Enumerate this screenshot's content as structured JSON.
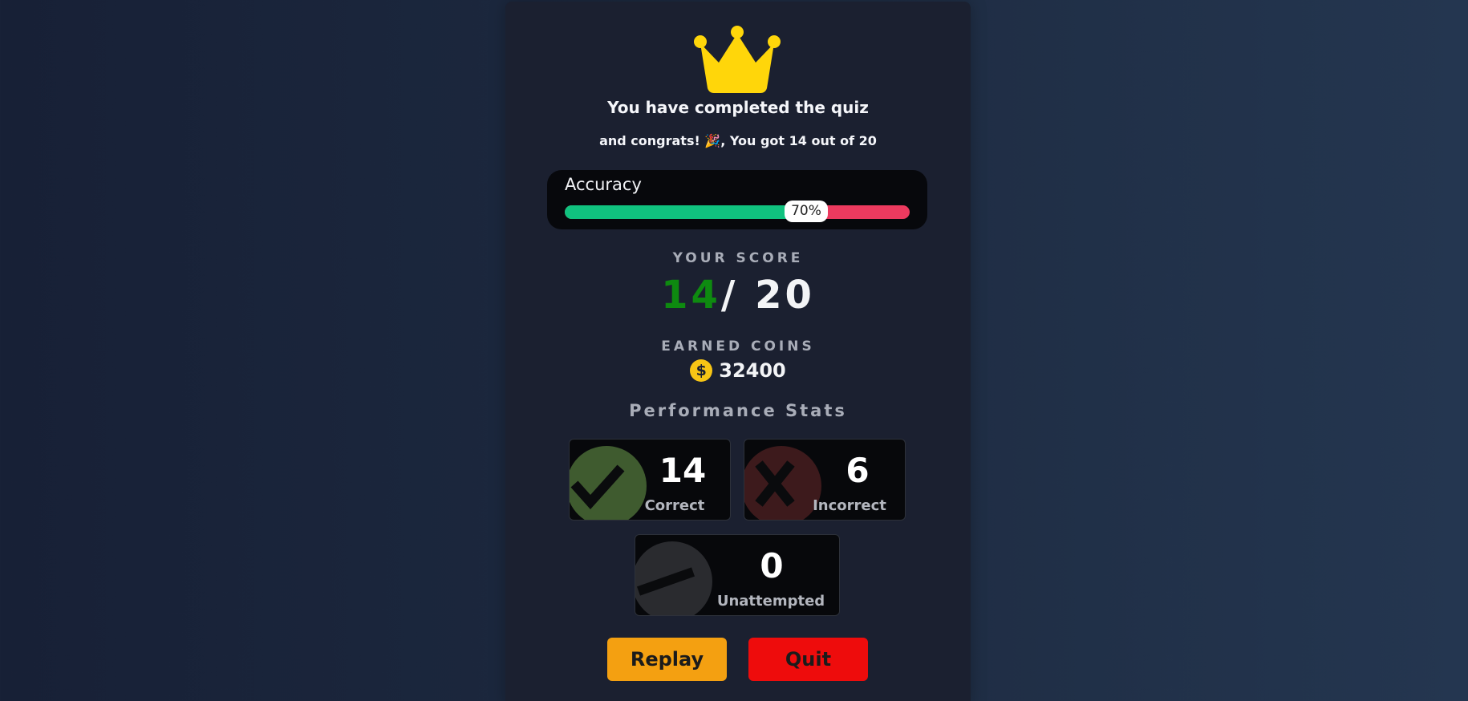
{
  "result": {
    "title": "You have completed the quiz",
    "subtitle_prefix": "and congrats! 🎉, You got",
    "subtitle_got": "14",
    "subtitle_mid": "out of",
    "subtitle_total": "20"
  },
  "accuracy": {
    "label": "Accuracy",
    "percent_text": "70%",
    "fraction": 0.7,
    "colors": {
      "correct": "#10c27f",
      "incorrect": "#ec3a5f"
    }
  },
  "score": {
    "caption": "YOUR SCORE",
    "got": "14",
    "total": "/ 20"
  },
  "coins": {
    "caption": "EARNED COINS",
    "icon": "dollar-coin-icon",
    "value": "32400"
  },
  "performance": {
    "title": "Performance Stats",
    "stats": [
      {
        "value": "14",
        "label": "Correct",
        "icon": "check-icon",
        "color": "#3f5b2f"
      },
      {
        "value": "6",
        "label": "Incorrect",
        "icon": "cross-icon",
        "color": "#3d1a1c"
      },
      {
        "value": "0",
        "label": "Unattempted",
        "icon": "dash-icon",
        "color": "#2a2b2f"
      }
    ]
  },
  "buttons": {
    "replay": "Replay",
    "quit": "Quit"
  }
}
